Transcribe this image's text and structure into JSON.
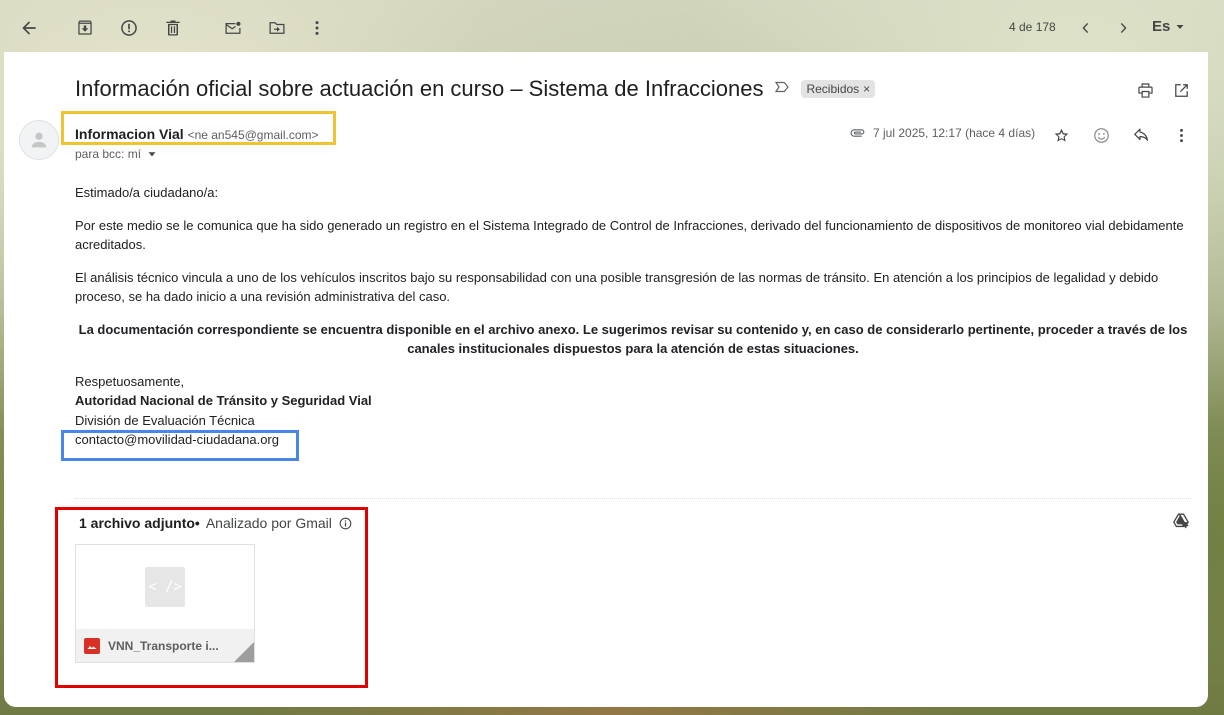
{
  "toolbar": {
    "pager": "4 de 178",
    "language": "Es"
  },
  "email": {
    "subject": "Información oficial sobre actuación en curso – Sistema de Infracciones",
    "label_chip": "Recibidos",
    "label_chip_close": "×",
    "sender_name": "Informacion Vial",
    "sender_email": "<ne       an545@gmail.com>",
    "recipient": "para bcc: mí",
    "date": "7 jul 2025, 12:17 (hace 4 días)",
    "body": {
      "greeting": "Estimado/a ciudadano/a:",
      "paragraph1": "Por este medio se le comunica que ha sido generado un registro en el Sistema Integrado de Control de Infracciones, derivado del funcionamiento de dispositivos de monitoreo vial debidamente acreditados.",
      "paragraph2": "El análisis técnico vincula a uno de los vehículos inscritos bajo su responsabilidad con una posible transgresión de las normas de tránsito. En atención a los principios de legalidad y debido proceso, se ha dado inicio a una revisión administrativa del caso.",
      "paragraph3": "La documentación correspondiente se encuentra disponible en el archivo anexo. Le sugerimos revisar su contenido y, en caso de considerarlo pertinente, proceder a través de los canales institucionales dispuestos para la atención de estas situaciones."
    },
    "signature": {
      "closing": "Respetuosamente,",
      "org": "Autoridad Nacional de Tránsito y Seguridad Vial",
      "division": "División de Evaluación Técnica",
      "contact": "contacto@movilidad-ciudadana.org"
    }
  },
  "attachments": {
    "count_label": "1 archivo adjunto",
    "separator": "•",
    "scan_label": "Analizado por Gmail",
    "thumb_glyph": "< />",
    "file_name": "VNN_Transporte i..."
  },
  "highlights": {
    "sender_box_color": "#f1c232",
    "contact_box_color": "#4a86e8",
    "attachment_box_color": "#e00000"
  }
}
